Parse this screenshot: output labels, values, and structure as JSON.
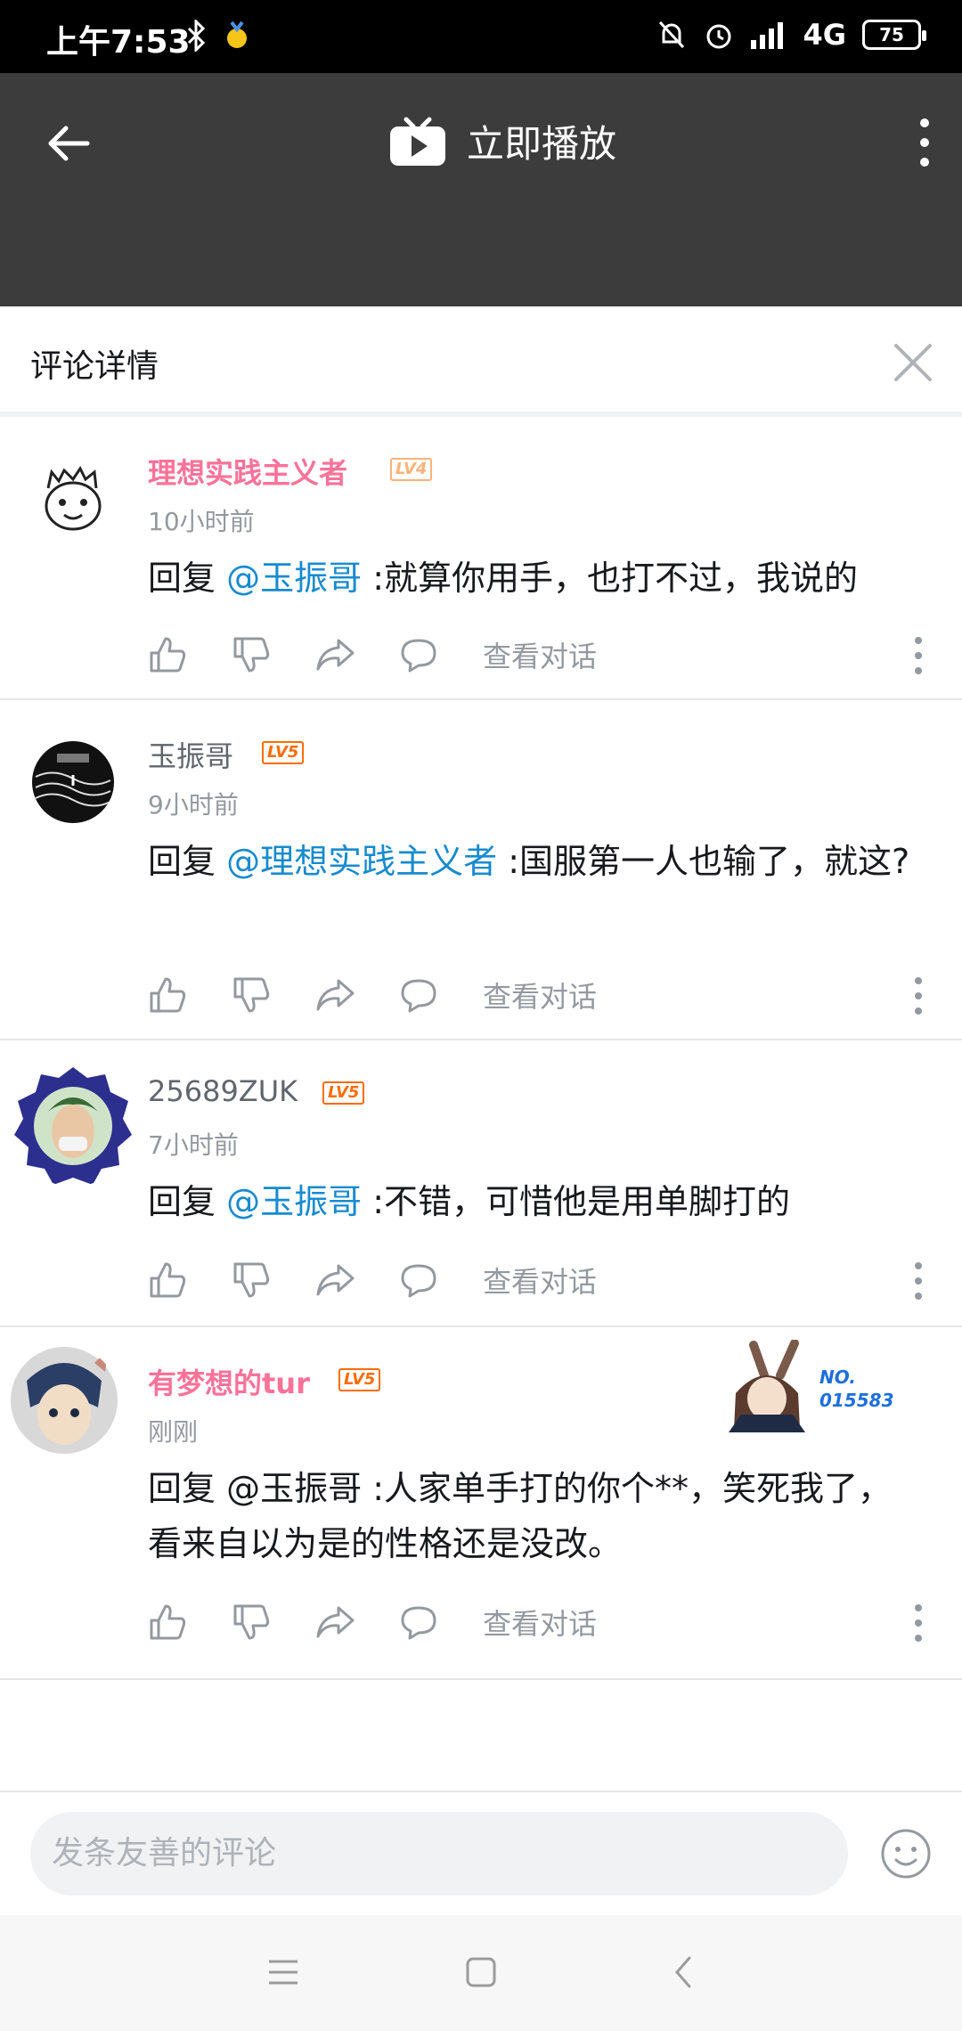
{
  "status_bar": {
    "time": "上午7:53",
    "network": "4G",
    "battery": "75"
  },
  "header": {
    "title": "立即播放"
  },
  "panel": {
    "title": "评论详情"
  },
  "comments": [
    {
      "username": "理想实践主义者",
      "level": "LV4",
      "time": "10小时前",
      "reply_prefix": "回复 ",
      "mention": "@玉振哥",
      "text": " :就算你用手，也打不过，我说的",
      "view_conversation": "查看对话"
    },
    {
      "username": "玉振哥",
      "level": "LV5",
      "time": "9小时前",
      "reply_prefix": "回复 ",
      "mention": "@理想实践主义者",
      "text": " :国服第一人也输了，就这?",
      "view_conversation": "查看对话"
    },
    {
      "username": "25689ZUK",
      "level": "LV5",
      "time": "7小时前",
      "reply_prefix": "回复 ",
      "mention": "@玉振哥",
      "text": " :不错，可惜他是用单脚打的",
      "view_conversation": "查看对话"
    },
    {
      "username": "有梦想的tur",
      "level": "LV5",
      "time": "刚刚",
      "reply_prefix": "回复 ",
      "mention": "@玉振哥",
      "text": " :人家单手打的你个**，笑死我了，看来自以为是的性格还是没改。",
      "view_conversation": "查看对话",
      "badge_text_1": "NO.",
      "badge_text_2": "015583"
    }
  ],
  "input": {
    "placeholder": "发条友善的评论"
  },
  "colors": {
    "vip_name": "#fb7299",
    "mention": "#178bcf",
    "header_bg": "#3c3c3c"
  }
}
